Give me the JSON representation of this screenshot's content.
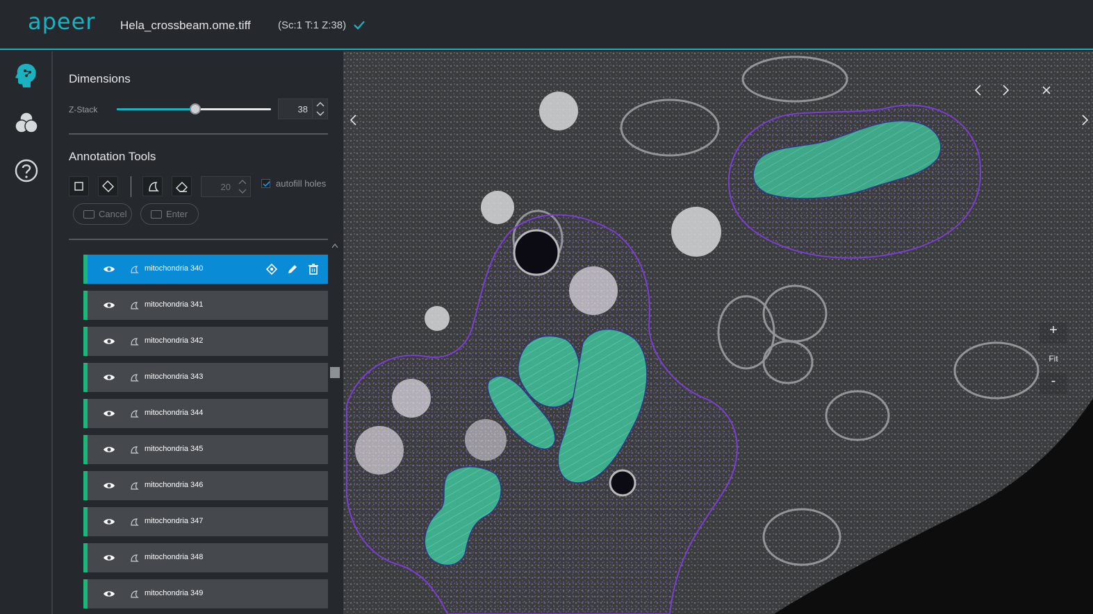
{
  "header": {
    "logo": "apeer",
    "filename": "Hela_crossbeam.ome.tiff",
    "position": "(Sc:1 T:1 Z:38)"
  },
  "rail": {
    "icons": [
      "ai-head-icon",
      "channels-icon",
      "help-icon"
    ]
  },
  "dimensions": {
    "title": "Dimensions",
    "zstack_label": "Z-Stack",
    "zstack_value": "38",
    "zstack_fraction": 0.51
  },
  "annotation_tools": {
    "title": "Annotation Tools",
    "brush_size": "20",
    "autofill_label": "autofill holes",
    "autofill_checked": true,
    "cancel_label": "Cancel",
    "enter_label": "Enter"
  },
  "annotations": [
    {
      "label": "mitochondria 340",
      "active": true
    },
    {
      "label": "mitochondria 341",
      "active": false
    },
    {
      "label": "mitochondria 342",
      "active": false
    },
    {
      "label": "mitochondria 343",
      "active": false
    },
    {
      "label": "mitochondria 344",
      "active": false
    },
    {
      "label": "mitochondria 345",
      "active": false
    },
    {
      "label": "mitochondria 346",
      "active": false
    },
    {
      "label": "mitochondria 347",
      "active": false
    },
    {
      "label": "mitochondria 348",
      "active": false
    },
    {
      "label": "mitochondria 349",
      "active": false
    }
  ],
  "viewer": {
    "zoom_in": "+",
    "fit": "Fit",
    "zoom_out": "-"
  },
  "colors": {
    "accent": "#1ab2c1",
    "active_row": "#0a8bd6",
    "row_marker": "#1fb47a",
    "mito_fill": "#3fae8c",
    "cell_outline": "#7a3fd0"
  }
}
